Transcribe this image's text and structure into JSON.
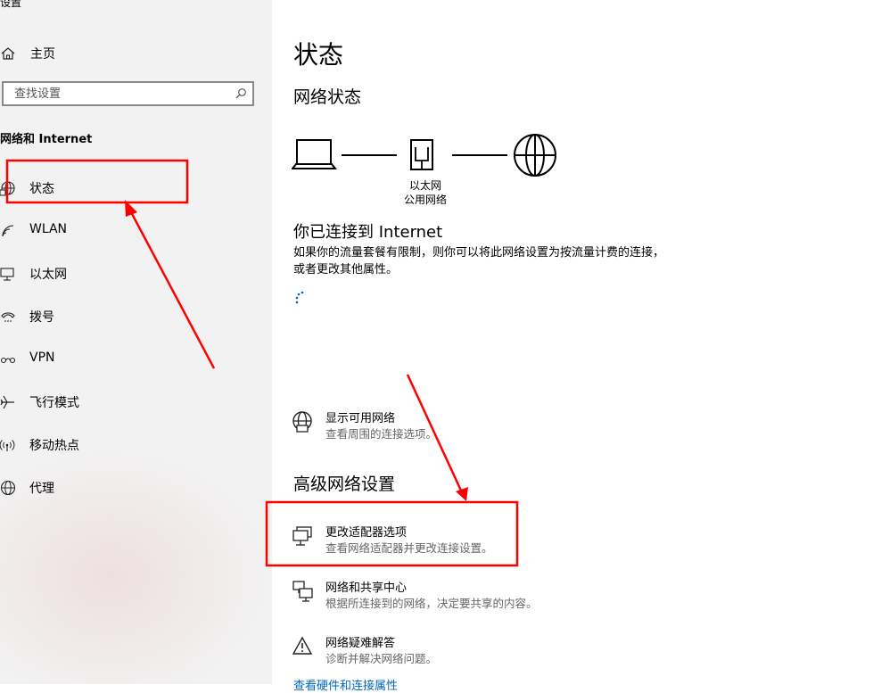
{
  "app": {
    "title": "设置"
  },
  "sidebar": {
    "home_label": "主页",
    "search_placeholder": "查找设置",
    "section_title": "网络和 Internet",
    "items": [
      {
        "label": "状态",
        "icon": "globe-status-icon"
      },
      {
        "label": "WLAN",
        "icon": "wifi-icon"
      },
      {
        "label": "以太网",
        "icon": "ethernet-icon"
      },
      {
        "label": "拨号",
        "icon": "dialup-icon"
      },
      {
        "label": "VPN",
        "icon": "vpn-icon"
      },
      {
        "label": "飞行模式",
        "icon": "airplane-icon"
      },
      {
        "label": "移动热点",
        "icon": "hotspot-icon"
      },
      {
        "label": "代理",
        "icon": "globe-icon"
      }
    ]
  },
  "main": {
    "title": "状态",
    "network_status_heading": "网络状态",
    "diagram": {
      "adapter_name": "以太网",
      "network_type": "公用网络"
    },
    "connected_text": "你已连接到 Internet",
    "description": "如果你的流量套餐有限制，则你可以将此网络设置为按流量计费的连接，或者更改其他属性。",
    "show_networks": {
      "title": "显示可用网络",
      "subtitle": "查看周围的连接选项。"
    },
    "advanced_heading": "高级网络设置",
    "advanced_items": [
      {
        "title": "更改适配器选项",
        "subtitle": "查看网络适配器并更改连接设置。",
        "icon": "adapter-icon"
      },
      {
        "title": "网络和共享中心",
        "subtitle": "根据所连接到的网络，决定要共享的内容。",
        "icon": "sharing-center-icon"
      },
      {
        "title": "网络疑难解答",
        "subtitle": "诊断并解决网络问题。",
        "icon": "warning-icon"
      }
    ],
    "bottom_link": "查看硬件和连接属性"
  },
  "annotations": {
    "color": "#ff0000"
  }
}
